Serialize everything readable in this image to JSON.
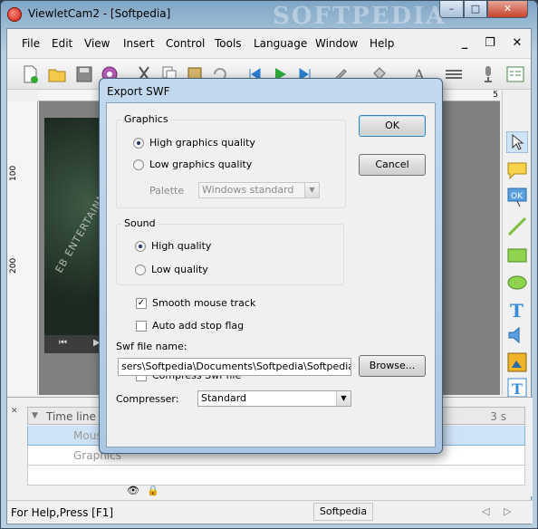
{
  "window": {
    "title": "ViewletCam2 - [Softpedia]",
    "watermark": "SOFTPEDIA",
    "controls": {
      "minimize": "–",
      "maximize": "□",
      "close": "✕"
    }
  },
  "menu": {
    "items": [
      "File",
      "Edit",
      "View",
      "Insert",
      "Control",
      "Tools",
      "Language",
      "Window",
      "Help"
    ],
    "mdi": {
      "minimize": "_",
      "restore": "❐",
      "close": "✕"
    }
  },
  "ruler": {
    "v_labels": [
      "100",
      "200"
    ],
    "h_mark": "5"
  },
  "canvas": {
    "movie_text": "EB ENTERTAINM"
  },
  "timeline": {
    "header": "Time line",
    "time": "3 s",
    "rows": [
      "Mouse",
      "Graphics"
    ]
  },
  "status": {
    "help": "For Help,Press [F1]",
    "pane": "Softpedia"
  },
  "dialog": {
    "title": "Export SWF",
    "graphics": {
      "label": "Graphics",
      "high": "High graphics quality",
      "low": "Low graphics quality",
      "palette_label": "Palette",
      "palette_value": "Windows standard"
    },
    "sound": {
      "label": "Sound",
      "high": "High quality",
      "low": "Low quality"
    },
    "smooth_mouse": "Smooth mouse track",
    "auto_stop": "Auto add stop flag",
    "file_label": "Swf file name:",
    "file_value": "sers\\Softpedia\\Documents\\Softpedia\\Softpedia.swf",
    "browse": "Browse...",
    "compressor_label": "Compresser:",
    "compressor_value": "Standard",
    "compress_swf": "Compress Swf file",
    "ok": "OK",
    "cancel": "Cancel",
    "state": {
      "graphics": "high",
      "sound": "high",
      "smooth_mouse": true,
      "auto_stop": false,
      "compress_swf": false
    }
  },
  "colors": {
    "accent": "#3c7fb1",
    "titlebar": "#9dbcd4",
    "close": "#c7432b"
  }
}
